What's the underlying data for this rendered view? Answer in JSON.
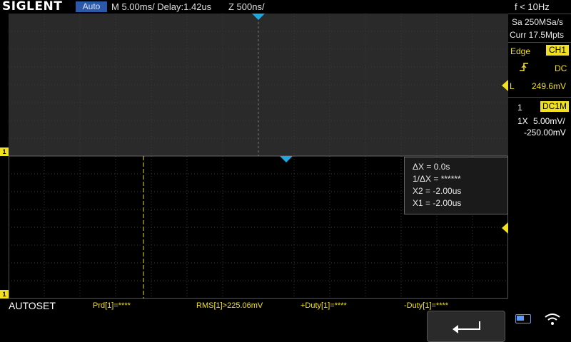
{
  "topbar": {
    "brand": "SIGLENT",
    "mode": "Auto",
    "timebase": "M 5.00ms/ Delay:1.42us",
    "zoom": "Z 500ns/"
  },
  "status": {
    "freq": "f < 10Hz",
    "sample_rate": "Sa 250MSa/s",
    "memory_depth": "Curr 17.5Mpts"
  },
  "trigger": {
    "type": "Edge",
    "source": "CH1",
    "slope_icon": "rising-edge-icon",
    "coupling": "DC",
    "level_prefix": "L",
    "level": "249.6mV"
  },
  "channel": {
    "number": "1",
    "coupling": "DC1M",
    "probe": "1X",
    "volts_div": "5.00mV/",
    "offset": "-250.00mV"
  },
  "cursor": {
    "dx": "ΔX = 0.0s",
    "inv_dx": "1/ΔX = ******",
    "x2": "X2 = -2.00us",
    "x1": "X1 = -2.00us"
  },
  "measurements": [
    "Prd[1]=****",
    "RMS[1]>225.06mV",
    "+Duty[1]=****",
    "-Duty[1]=****"
  ],
  "autoset_label": "AUTOSET",
  "channel_markers": [
    "1",
    "1"
  ],
  "colors": {
    "channel1": "#f0e020",
    "trigger_marker": "#1fa8e0",
    "mode_badge": "#2b59a8"
  },
  "icons": {
    "back": "back-arrow-icon",
    "battery": "battery-icon",
    "wifi": "wifi-icon"
  }
}
